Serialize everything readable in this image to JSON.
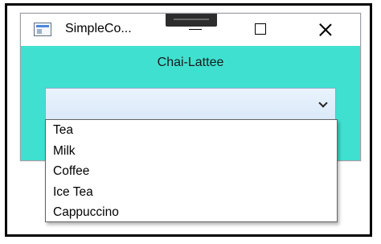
{
  "window": {
    "title": "SimpleCo...",
    "icons": {
      "app": "app-window-icon",
      "minimize": "minimize-icon",
      "maximize": "maximize-icon",
      "close": "close-icon"
    }
  },
  "main": {
    "label": "Chai-Lattee",
    "background": "#40e0d0",
    "combo": {
      "selected": "",
      "icon": "chevron-down-icon",
      "options": [
        "Tea",
        "Milk",
        "Coffee",
        "Ice Tea",
        "Cappuccino"
      ]
    }
  }
}
